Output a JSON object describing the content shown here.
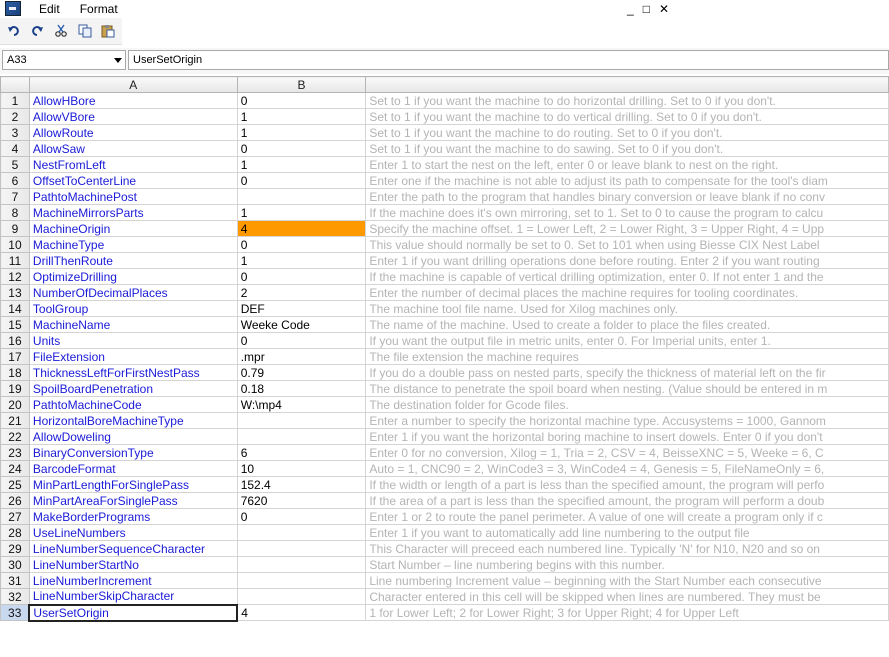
{
  "menubar": {
    "items": [
      "Edit",
      "Format"
    ]
  },
  "window_controls": [
    "_",
    "□",
    "✕"
  ],
  "toolbar": {
    "buttons": [
      "undo-icon",
      "redo-icon",
      "cut-icon",
      "copy-icon",
      "paste-icon"
    ]
  },
  "formula_bar": {
    "cell_ref": "A33",
    "content": "UserSetOrigin"
  },
  "columns": [
    "A",
    "B",
    ""
  ],
  "rows": [
    {
      "n": "1",
      "name": "AllowHBore",
      "value": "0",
      "desc": "Set to 1 if you want the machine to do horizontal drilling. Set to 0 if you don't."
    },
    {
      "n": "2",
      "name": "AllowVBore",
      "value": "1",
      "desc": "Set to 1 if you want the machine to do vertical drilling. Set to 0 if you don't."
    },
    {
      "n": "3",
      "name": "AllowRoute",
      "value": "1",
      "desc": "Set to 1 if you want the machine to do routing. Set to 0 if you don't."
    },
    {
      "n": "4",
      "name": "AllowSaw",
      "value": "0",
      "desc": "Set to 1 if you want the machine to do sawing. Set to 0 if you don't."
    },
    {
      "n": "5",
      "name": "NestFromLeft",
      "value": "1",
      "desc": "Enter 1 to start the nest on the left, enter 0 or leave blank to nest on the right."
    },
    {
      "n": "6",
      "name": "OffsetToCenterLine",
      "value": "0",
      "desc": "Enter one if the machine is not able to adjust its path to compensate for the tool's diam"
    },
    {
      "n": "7",
      "name": "PathtoMachinePost",
      "value": "",
      "desc": "Enter the path to the program that handles binary conversion or leave blank if no conv"
    },
    {
      "n": "8",
      "name": "MachineMirrorsParts",
      "value": "1",
      "desc": "If the machine does it's own mirroring, set to 1. Set to 0 to cause the program to calcu"
    },
    {
      "n": "9",
      "name": "MachineOrigin",
      "value": "4",
      "desc": "Specify the machine offset. 1 = Lower Left, 2 = Lower Right, 3 = Upper Right, 4 = Upp"
    },
    {
      "n": "10",
      "name": "MachineType",
      "value": "0",
      "desc": "This value should normally be set to 0.  Set to 101 when using Biesse CIX Nest Label"
    },
    {
      "n": "11",
      "name": "DrillThenRoute",
      "value": "1",
      "desc": "Enter 1 if you want drilling operations done before routing. Enter 2 if you want routing"
    },
    {
      "n": "12",
      "name": "OptimizeDrilling",
      "value": "0",
      "desc": "If the machine is capable of vertical drilling optimization, enter 0. If not enter 1 and the"
    },
    {
      "n": "13",
      "name": "NumberOfDecimalPlaces",
      "value": "2",
      "desc": "Enter the number of decimal places the machine requires for tooling coordinates."
    },
    {
      "n": "14",
      "name": "ToolGroup",
      "value": "DEF",
      "desc": "The machine tool file name. Used for Xilog machines only."
    },
    {
      "n": "15",
      "name": "MachineName",
      "value": "Weeke Code",
      "desc": "The name of the machine. Used to create a folder to place the files created."
    },
    {
      "n": "16",
      "name": "Units",
      "value": "0",
      "desc": "If you want the output file in metric units, enter 0. For Imperial units, enter 1."
    },
    {
      "n": "17",
      "name": "FileExtension",
      "value": ".mpr",
      "desc": "The file extension the machine requires"
    },
    {
      "n": "18",
      "name": "ThicknessLeftForFirstNestPass",
      "value": "0.79",
      "desc": "If you do a double pass on nested parts, specify the thickness of material left on the fir"
    },
    {
      "n": "19",
      "name": "SpoilBoardPenetration",
      "value": "0.18",
      "desc": "The distance to penetrate the spoil board when nesting. (Value should be entered in m"
    },
    {
      "n": "20",
      "name": "PathtoMachineCode",
      "value": "W:\\mp4",
      "desc": "The destination folder for Gcode files."
    },
    {
      "n": "21",
      "name": "HorizontalBoreMachineType",
      "value": "",
      "desc": "Enter a number to specify the horizontal machine type. Accusystems = 1000, Gannom"
    },
    {
      "n": "22",
      "name": "AllowDoweling",
      "value": "",
      "desc": "Enter 1 if you want the horizontal boring machine to insert dowels. Enter 0 if you don't"
    },
    {
      "n": "23",
      "name": "BinaryConversionType",
      "value": "6",
      "desc": "Enter 0 for no conversion, Xilog = 1, Tria = 2, CSV = 4, BeisseXNC = 5, Weeke = 6, C"
    },
    {
      "n": "24",
      "name": "BarcodeFormat",
      "value": "10",
      "desc": "Auto = 1, CNC90 = 2, WinCode3 = 3, WinCode4 = 4, Genesis = 5, FileNameOnly = 6,"
    },
    {
      "n": "25",
      "name": "MinPartLengthForSinglePass",
      "value": "152.4",
      "desc": "If the width or length of a part is less than the specified amount, the program will perfo"
    },
    {
      "n": "26",
      "name": "MinPartAreaForSinglePass",
      "value": "7620",
      "desc": "If the area of a part is less than the specified amount, the program will perform a doub"
    },
    {
      "n": "27",
      "name": "MakeBorderPrograms",
      "value": "0",
      "desc": "Enter 1 or 2 to route the panel perimeter. A value of one will create a program only if c"
    },
    {
      "n": "28",
      "name": "UseLineNumbers",
      "value": "",
      "desc": "Enter 1 if you want to automatically add line numbering to the output file"
    },
    {
      "n": "29",
      "name": "LineNumberSequenceCharacter",
      "value": "",
      "desc": "This Character will preceed each numbered line.  Typically 'N' for N10, N20 and so on"
    },
    {
      "n": "30",
      "name": "LineNumberStartNo",
      "value": "",
      "desc": "Start Number – line numbering begins with this number."
    },
    {
      "n": "31",
      "name": "LineNumberIncrement",
      "value": "",
      "desc": "Line numbering Increment value – beginning with the Start Number each consecutive"
    },
    {
      "n": "32",
      "name": "LineNumberSkipCharacter",
      "value": "",
      "desc": "Character entered in this cell will be skipped when lines are numbered.  They must be"
    },
    {
      "n": "33",
      "name": "UserSetOrigin",
      "value": "4",
      "desc": "1 for Lower Left; 2 for Lower Right; 3 for Upper Right; 4 for Upper Left"
    }
  ],
  "colors": {
    "highlight": "#ff9900",
    "name_text": "#1a1ad8",
    "desc_text": "#b4b4b4"
  }
}
